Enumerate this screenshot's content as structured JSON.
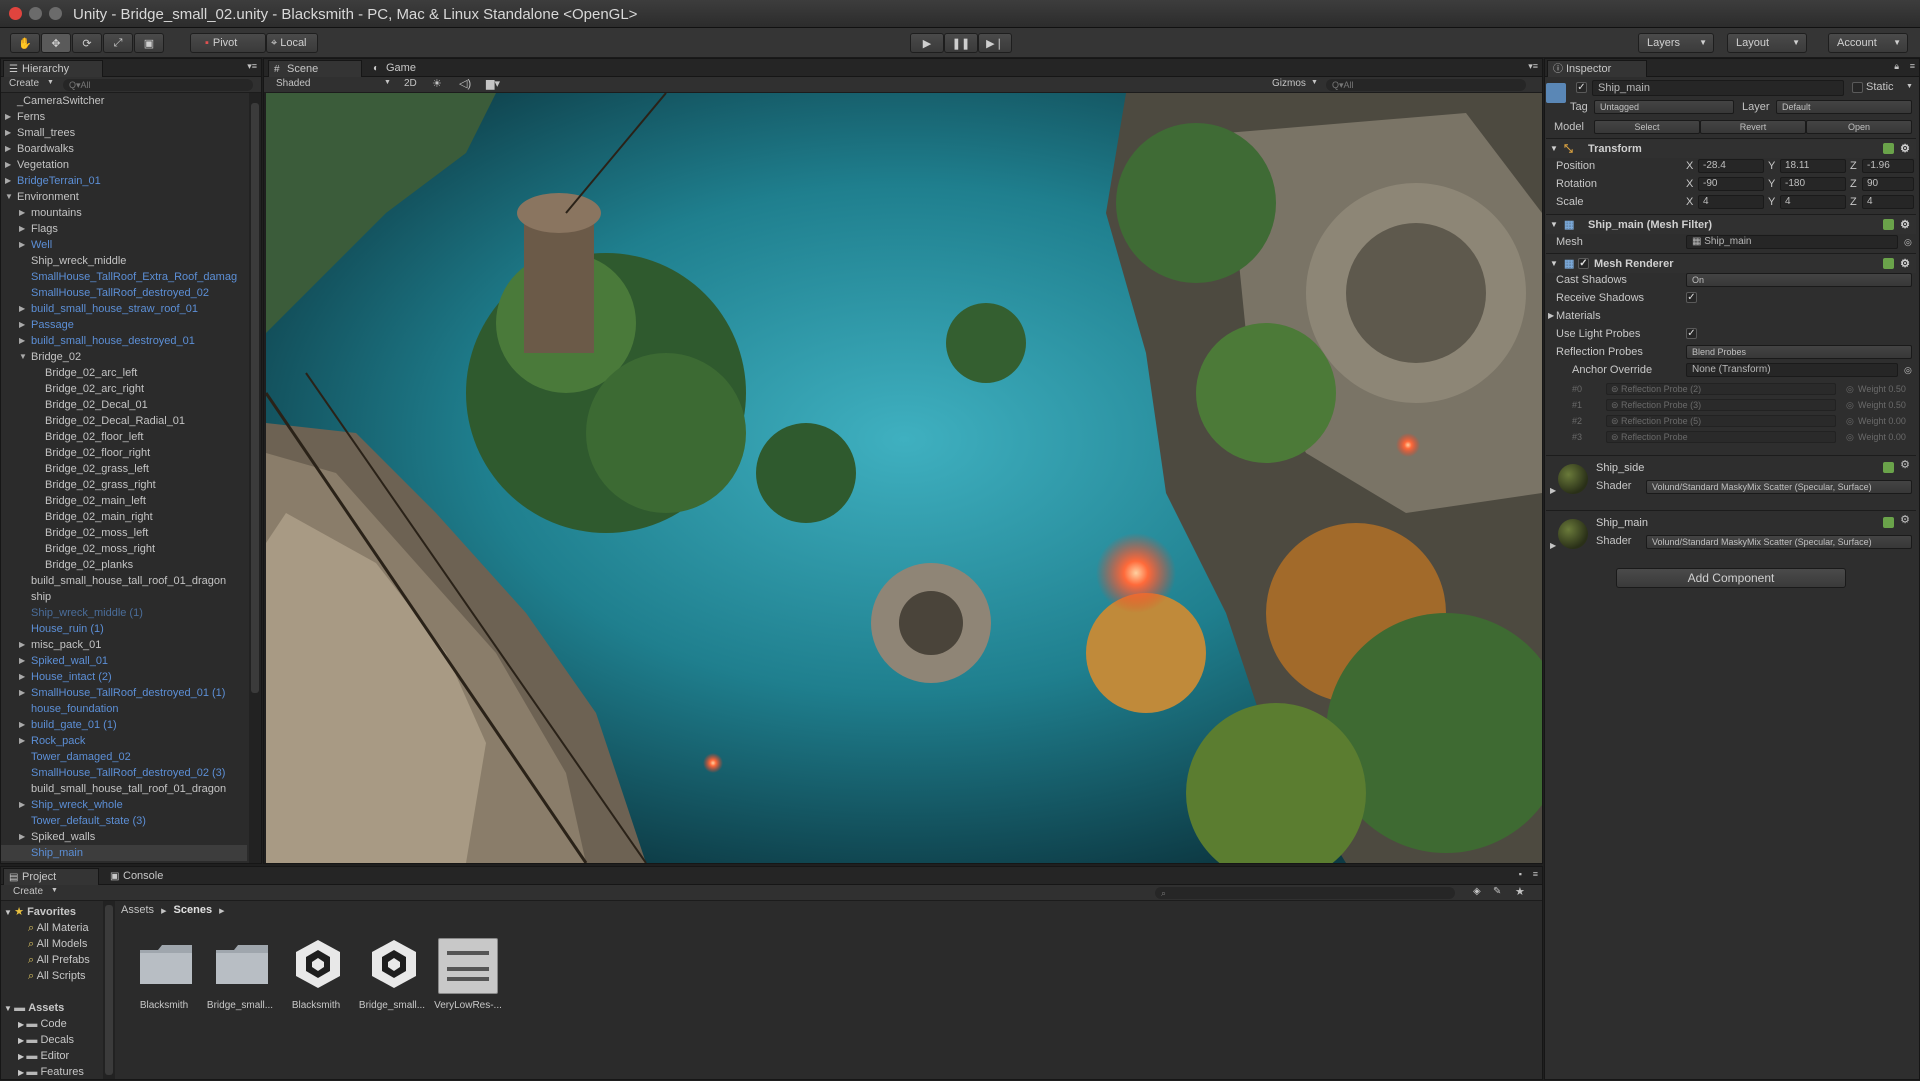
{
  "window": {
    "title": "Unity - Bridge_small_02.unity - Blacksmith - PC, Mac & Linux Standalone <OpenGL>"
  },
  "toolbar": {
    "pivot_label": "Pivot",
    "local_label": "Local",
    "layers_label": "Layers",
    "layout_label": "Layout",
    "account_label": "Account"
  },
  "hierarchy": {
    "tab": "Hierarchy",
    "create_label": "Create",
    "search_placeholder": "Q▾All",
    "items": [
      {
        "label": "_CameraSwitcher",
        "blue": false,
        "indent": 0,
        "arrow": false
      },
      {
        "label": "Ferns",
        "blue": false,
        "indent": 0,
        "arrow": true
      },
      {
        "label": "Small_trees",
        "blue": false,
        "indent": 0,
        "arrow": true
      },
      {
        "label": "Boardwalks",
        "blue": false,
        "indent": 0,
        "arrow": true
      },
      {
        "label": "Vegetation",
        "blue": false,
        "indent": 0,
        "arrow": true
      },
      {
        "label": "BridgeTerrain_01",
        "blue": true,
        "indent": 0,
        "arrow": true
      },
      {
        "label": "Environment",
        "blue": false,
        "indent": 0,
        "arrow": true,
        "open": true
      },
      {
        "label": "mountains",
        "blue": false,
        "indent": 1,
        "arrow": true
      },
      {
        "label": "Flags",
        "blue": false,
        "indent": 1,
        "arrow": true
      },
      {
        "label": "Well",
        "blue": true,
        "indent": 1,
        "arrow": true
      },
      {
        "label": "Ship_wreck_middle",
        "blue": false,
        "indent": 1,
        "arrow": false
      },
      {
        "label": "SmallHouse_TallRoof_Extra_Roof_damag",
        "blue": true,
        "indent": 1,
        "arrow": false
      },
      {
        "label": "SmallHouse_TallRoof_destroyed_02",
        "blue": true,
        "indent": 1,
        "arrow": false
      },
      {
        "label": "build_small_house_straw_roof_01",
        "blue": true,
        "indent": 1,
        "arrow": true
      },
      {
        "label": "Passage",
        "blue": true,
        "indent": 1,
        "arrow": true
      },
      {
        "label": "build_small_house_destroyed_01",
        "blue": true,
        "indent": 1,
        "arrow": true
      },
      {
        "label": "Bridge_02",
        "blue": false,
        "indent": 1,
        "arrow": true,
        "open": true
      },
      {
        "label": "Bridge_02_arc_left",
        "blue": false,
        "indent": 2,
        "arrow": false
      },
      {
        "label": "Bridge_02_arc_right",
        "blue": false,
        "indent": 2,
        "arrow": false
      },
      {
        "label": "Bridge_02_Decal_01",
        "blue": false,
        "indent": 2,
        "arrow": false
      },
      {
        "label": "Bridge_02_Decal_Radial_01",
        "blue": false,
        "indent": 2,
        "arrow": false
      },
      {
        "label": "Bridge_02_floor_left",
        "blue": false,
        "indent": 2,
        "arrow": false
      },
      {
        "label": "Bridge_02_floor_right",
        "blue": false,
        "indent": 2,
        "arrow": false
      },
      {
        "label": "Bridge_02_grass_left",
        "blue": false,
        "indent": 2,
        "arrow": false
      },
      {
        "label": "Bridge_02_grass_right",
        "blue": false,
        "indent": 2,
        "arrow": false
      },
      {
        "label": "Bridge_02_main_left",
        "blue": false,
        "indent": 2,
        "arrow": false
      },
      {
        "label": "Bridge_02_main_right",
        "blue": false,
        "indent": 2,
        "arrow": false
      },
      {
        "label": "Bridge_02_moss_left",
        "blue": false,
        "indent": 2,
        "arrow": false
      },
      {
        "label": "Bridge_02_moss_right",
        "blue": false,
        "indent": 2,
        "arrow": false
      },
      {
        "label": "Bridge_02_planks",
        "blue": false,
        "indent": 2,
        "arrow": false
      },
      {
        "label": "build_small_house_tall_roof_01_dragon",
        "blue": false,
        "indent": 1,
        "arrow": false
      },
      {
        "label": "ship",
        "blue": false,
        "indent": 1,
        "arrow": false
      },
      {
        "label": "Ship_wreck_middle (1)",
        "blue": true,
        "dim": true,
        "indent": 1,
        "arrow": false
      },
      {
        "label": "House_ruin (1)",
        "blue": true,
        "indent": 1,
        "arrow": false
      },
      {
        "label": "misc_pack_01",
        "blue": false,
        "indent": 1,
        "arrow": true
      },
      {
        "label": "Spiked_wall_01",
        "blue": true,
        "indent": 1,
        "arrow": true
      },
      {
        "label": "House_intact (2)",
        "blue": true,
        "indent": 1,
        "arrow": true
      },
      {
        "label": "SmallHouse_TallRoof_destroyed_01 (1)",
        "blue": true,
        "indent": 1,
        "arrow": true
      },
      {
        "label": "house_foundation",
        "blue": true,
        "indent": 1,
        "arrow": false
      },
      {
        "label": "build_gate_01 (1)",
        "blue": true,
        "indent": 1,
        "arrow": true
      },
      {
        "label": "Rock_pack",
        "blue": true,
        "indent": 1,
        "arrow": true
      },
      {
        "label": "Tower_damaged_02",
        "blue": true,
        "indent": 1,
        "arrow": false
      },
      {
        "label": "SmallHouse_TallRoof_destroyed_02 (3)",
        "blue": true,
        "indent": 1,
        "arrow": false
      },
      {
        "label": "build_small_house_tall_roof_01_dragon",
        "blue": false,
        "indent": 1,
        "arrow": false
      },
      {
        "label": "Ship_wreck_whole",
        "blue": true,
        "indent": 1,
        "arrow": true
      },
      {
        "label": "Tower_default_state (3)",
        "blue": true,
        "indent": 1,
        "arrow": false
      },
      {
        "label": "Spiked_walls",
        "blue": false,
        "indent": 1,
        "arrow": true
      },
      {
        "label": "Ship_main",
        "blue": true,
        "indent": 1,
        "arrow": false,
        "selected": true
      }
    ]
  },
  "scene": {
    "tab_scene": "Scene",
    "tab_game": "Game",
    "shading": "Shaded",
    "mode_2d": "2D",
    "gizmos": "Gizmos",
    "search": "Q▾All"
  },
  "inspector": {
    "tab": "Inspector",
    "object_name": "Ship_main",
    "static_label": "Static",
    "tag_label": "Tag",
    "tag_value": "Untagged",
    "layer_label": "Layer",
    "layer_value": "Default",
    "model_label": "Model",
    "model_select": "Select",
    "model_revert": "Revert",
    "model_open": "Open",
    "transform": {
      "title": "Transform",
      "position_label": "Position",
      "rotation_label": "Rotation",
      "scale_label": "Scale",
      "position": {
        "x": "-28.4",
        "y": "18.11",
        "z": "-1.96"
      },
      "rotation": {
        "x": "-90",
        "y": "-180",
        "z": "90"
      },
      "scale": {
        "x": "4",
        "y": "4",
        "z": "4"
      }
    },
    "mesh_filter": {
      "title": "Ship_main (Mesh Filter)",
      "mesh_label": "Mesh",
      "mesh_value": "Ship_main"
    },
    "mesh_renderer": {
      "title": "Mesh Renderer",
      "cast_shadows_label": "Cast Shadows",
      "cast_shadows_value": "On",
      "receive_shadows_label": "Receive Shadows",
      "materials_label": "Materials",
      "light_probes_label": "Use Light Probes",
      "reflection_label": "Reflection Probes",
      "reflection_value": "Blend Probes",
      "anchor_label": "Anchor Override",
      "anchor_value": "None (Transform)",
      "probes": [
        {
          "index": "#0",
          "name": "Reflection Probe (2)",
          "weight": "Weight 0.50"
        },
        {
          "index": "#1",
          "name": "Reflection Probe (3)",
          "weight": "Weight 0.50"
        },
        {
          "index": "#2",
          "name": "Reflection Probe (5)",
          "weight": "Weight 0.00"
        },
        {
          "index": "#3",
          "name": "Reflection Probe",
          "weight": "Weight 0.00"
        }
      ]
    },
    "materials": [
      {
        "name": "Ship_side",
        "shader_label": "Shader",
        "shader": "Volund/Standard MaskyMix Scatter (Specular, Surface)"
      },
      {
        "name": "Ship_main",
        "shader_label": "Shader",
        "shader": "Volund/Standard MaskyMix Scatter (Specular, Surface)"
      }
    ],
    "add_component": "Add Component"
  },
  "project": {
    "tab_project": "Project",
    "tab_console": "Console",
    "create_label": "Create",
    "breadcrumb": [
      "Assets",
      "Scenes"
    ],
    "favorites_label": "Favorites",
    "favorites": [
      "All Materia",
      "All Models",
      "All Prefabs",
      "All Scripts"
    ],
    "assets_label": "Assets",
    "folders": [
      "Code",
      "Decals",
      "Editor",
      "Features"
    ],
    "assets": [
      {
        "label": "Blacksmith",
        "type": "folder"
      },
      {
        "label": "Bridge_small...",
        "type": "folder"
      },
      {
        "label": "Blacksmith",
        "type": "unity"
      },
      {
        "label": "Bridge_small...",
        "type": "unity"
      },
      {
        "label": "VeryLowRes-...",
        "type": "settings"
      }
    ]
  }
}
